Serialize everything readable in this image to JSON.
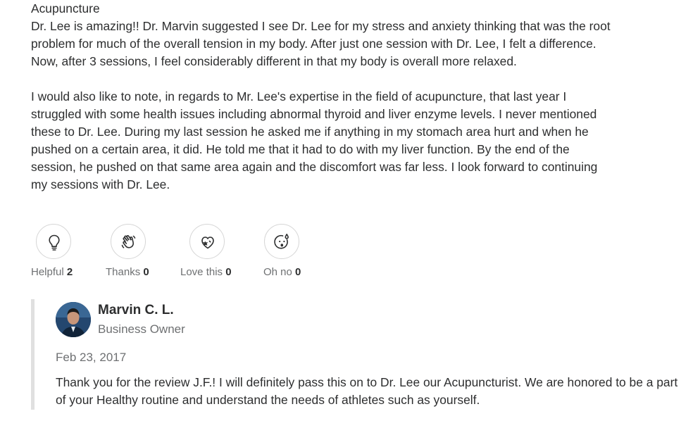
{
  "review": {
    "heading": "Acupuncture",
    "paragraph1": "Dr. Lee is amazing!! Dr. Marvin suggested I see Dr. Lee for my stress and anxiety thinking that was the root problem for much of the overall tension in my body. After just one session with Dr. Lee, I felt a difference. Now, after 3 sessions, I feel considerably different in that my body is overall more relaxed.",
    "paragraph2": "I would also like to note, in regards to Mr. Lee's expertise in the field of acupuncture, that last year I struggled with some health issues including abnormal thyroid and liver enzyme levels. I never mentioned these to Dr. Lee. During my last session he asked me if anything in my stomach area hurt and when he pushed on a certain area, it did. He told me that it had to do with my liver function. By the end of the session, he pushed on that same area again and the discomfort was far less. I look forward to continuing my sessions with Dr. Lee."
  },
  "reactions": [
    {
      "label": "Helpful",
      "count": "2",
      "icon": "lightbulb-icon"
    },
    {
      "label": "Thanks",
      "count": "0",
      "icon": "waving-hand-icon"
    },
    {
      "label": "Love this",
      "count": "0",
      "icon": "heart-icon"
    },
    {
      "label": "Oh no",
      "count": "0",
      "icon": "surprised-face-icon"
    }
  ],
  "owner_reply": {
    "name": "Marvin C. L.",
    "role": "Business Owner",
    "date": "Feb 23, 2017",
    "text": "Thank you for the review J.F.! I will definitely pass this on to Dr. Lee our Acupuncturist. We are honored to be a part of your Healthy routine and understand the needs of athletes such as yourself."
  },
  "colors": {
    "text": "#2d2e2f",
    "muted": "#6e7072",
    "border": "#d6d6d6",
    "reply_bar": "#e0e0e0"
  }
}
